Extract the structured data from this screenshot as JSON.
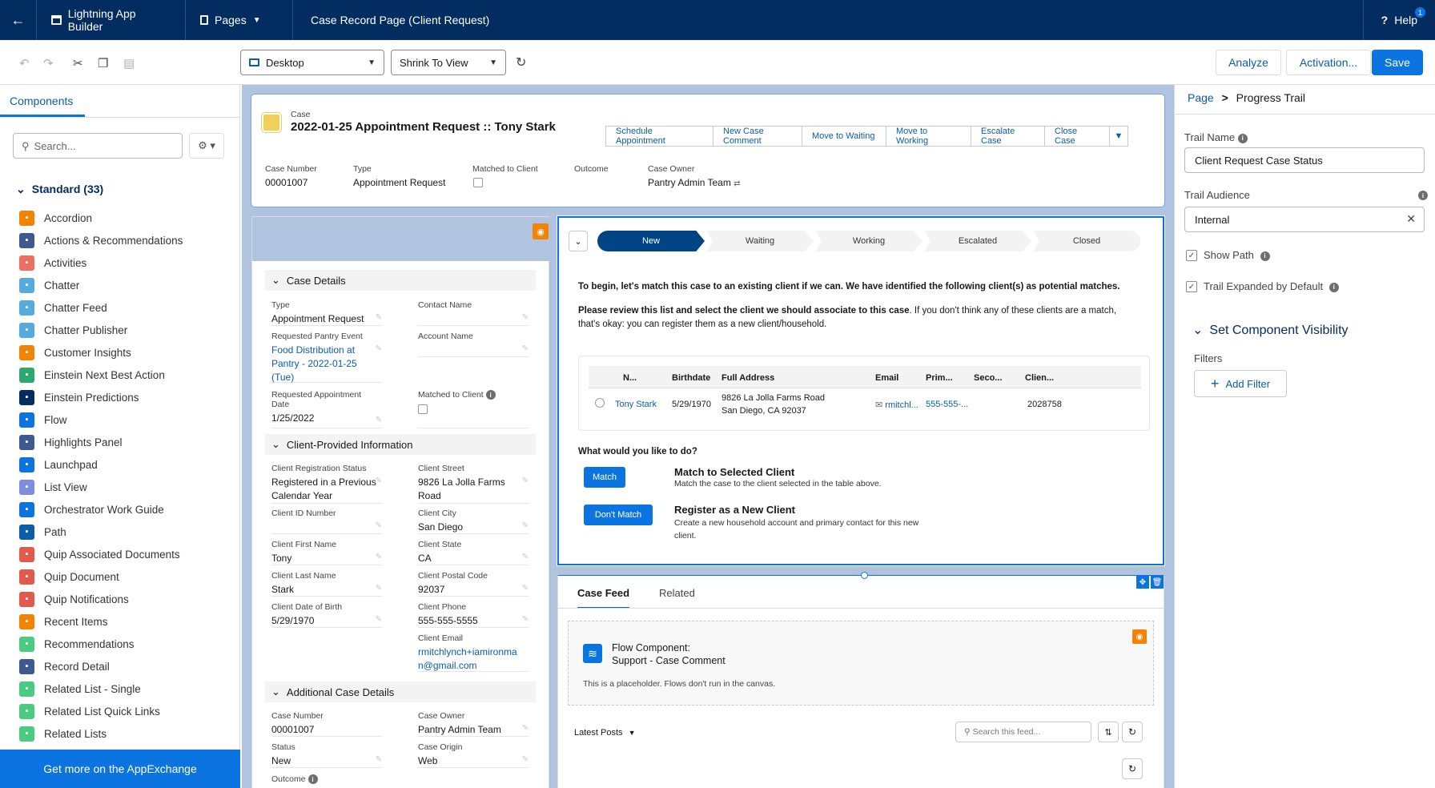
{
  "topbar": {
    "back": "←",
    "app_name": "Lightning App Builder",
    "pages": "Pages",
    "page_title": "Case Record Page (Client Request)",
    "help": "Help",
    "help_badge": "1"
  },
  "toolbar": {
    "device": "Desktop",
    "zoom": "Shrink To View",
    "analyze": "Analyze",
    "activation": "Activation...",
    "save": "Save"
  },
  "left": {
    "tab": "Components",
    "search_placeholder": "Search...",
    "standard_header": "Standard (33)",
    "items": [
      {
        "label": "Accordion",
        "color": "#f38303"
      },
      {
        "label": "Actions & Recommendations",
        "color": "#3c5a8f"
      },
      {
        "label": "Activities",
        "color": "#ef6e64"
      },
      {
        "label": "Chatter",
        "color": "#56aadf"
      },
      {
        "label": "Chatter Feed",
        "color": "#56aadf"
      },
      {
        "label": "Chatter Publisher",
        "color": "#56aadf"
      },
      {
        "label": "Customer Insights",
        "color": "#f38303"
      },
      {
        "label": "Einstein Next Best Action",
        "color": "#2ea86f"
      },
      {
        "label": "Einstein Predictions",
        "color": "#032d60"
      },
      {
        "label": "Flow",
        "color": "#0b74e1"
      },
      {
        "label": "Highlights Panel",
        "color": "#3c5a8f"
      },
      {
        "label": "Launchpad",
        "color": "#0b74e1"
      },
      {
        "label": "List View",
        "color": "#7f8de1"
      },
      {
        "label": "Orchestrator Work Guide",
        "color": "#0b74e1"
      },
      {
        "label": "Path",
        "color": "#0b5cab"
      },
      {
        "label": "Quip Associated Documents",
        "color": "#e15a4b"
      },
      {
        "label": "Quip Document",
        "color": "#e15a4b"
      },
      {
        "label": "Quip Notifications",
        "color": "#e15a4b"
      },
      {
        "label": "Recent Items",
        "color": "#f38303"
      },
      {
        "label": "Recommendations",
        "color": "#4bca81"
      },
      {
        "label": "Record Detail",
        "color": "#3c5a8f"
      },
      {
        "label": "Related List - Single",
        "color": "#4bca81"
      },
      {
        "label": "Related List Quick Links",
        "color": "#4bca81"
      },
      {
        "label": "Related Lists",
        "color": "#4bca81"
      }
    ],
    "appexchange": "Get more on the AppExchange"
  },
  "record": {
    "object": "Case",
    "title": "2022-01-25 Appointment Request :: Tony Stark",
    "actions": [
      "Schedule Appointment",
      "New Case Comment",
      "Move to Waiting",
      "Move to Working",
      "Escalate Case",
      "Close Case"
    ],
    "highlights": [
      {
        "label": "Case Number",
        "value": "00001007"
      },
      {
        "label": "Type",
        "value": "Appointment Request"
      },
      {
        "label": "Matched to Client",
        "value": ""
      },
      {
        "label": "Outcome",
        "value": ""
      },
      {
        "label": "Case Owner",
        "value": "Pantry Admin Team"
      }
    ]
  },
  "details": {
    "sec1": "Case Details",
    "sec2": "Client-Provided Information",
    "sec3": "Additional Case Details",
    "type_l": "Type",
    "type_v": "Appointment Request",
    "contact_l": "Contact Name",
    "event_l": "Requested Pantry Event",
    "event_v": "Food Distribution at Pantry - 2022-01-25 (Tue)",
    "account_l": "Account Name",
    "apptdate_l": "Requested Appointment Date",
    "apptdate_v": "1/25/2022",
    "matched_l": "Matched to Client",
    "regstatus_l": "Client Registration Status",
    "regstatus_v": "Registered in a Previous Calendar Year",
    "street_l": "Client Street",
    "street_v": "9826 La Jolla Farms Road",
    "clientid_l": "Client ID Number",
    "city_l": "Client City",
    "city_v": "San Diego",
    "first_l": "Client First Name",
    "first_v": "Tony",
    "state_l": "Client State",
    "state_v": "CA",
    "last_l": "Client Last Name",
    "last_v": "Stark",
    "postal_l": "Client Postal Code",
    "postal_v": "92037",
    "dob_l": "Client Date of Birth",
    "dob_v": "5/29/1970",
    "phone_l": "Client Phone",
    "phone_v": "555-555-5555",
    "email_l": "Client Email",
    "email_v": "rmitchlynch+iamironman@gmail.com",
    "casenum_l": "Case Number",
    "casenum_v": "00001007",
    "owner_l": "Case Owner",
    "owner_v": "Pantry Admin Team",
    "status_l": "Status",
    "status_v": "New",
    "origin_l": "Case Origin",
    "origin_v": "Web",
    "outcome_l": "Outcome"
  },
  "path": {
    "steps": [
      "New",
      "Waiting",
      "Working",
      "Escalated",
      "Closed"
    ],
    "intro": "To begin, let's match this case to an existing client if we can. We have identified the following client(s) as potential matches.",
    "review_bold": "Please review this list and select the client we should associate to this case",
    "review_rest": ". If you don't think any of these clients are a match, that's okay: you can register them as a new client/household.",
    "columns": [
      "N...",
      "Birthdate",
      "Full Address",
      "Email",
      "Prim...",
      "Seco...",
      "Clien..."
    ],
    "row": {
      "name": "Tony Stark",
      "birthdate": "5/29/1970",
      "addr1": "9826 La Jolla Farms Road",
      "addr2": "San Diego, CA 92037",
      "email": "rmitchl...",
      "phone": "555-555-...",
      "secondary": "",
      "client": "2028758"
    },
    "question": "What would you like to do?",
    "match_btn": "Match",
    "match_title": "Match to Selected Client",
    "match_desc": "Match the case to the client selected in the table above.",
    "nomatch_btn": "Don't Match",
    "register_title": "Register as a New Client",
    "register_desc": "Create a new household account and primary contact for this new client."
  },
  "feed": {
    "tab1": "Case Feed",
    "tab2": "Related",
    "flow_title1": "Flow Component:",
    "flow_title2": "Support - Case Comment",
    "placeholder": "This is a placeholder. Flows don't run in the canvas.",
    "latest": "Latest Posts",
    "search_placeholder": "Search this feed..."
  },
  "right": {
    "breadcrumb_page": "Page",
    "breadcrumb_sep": ">",
    "breadcrumb_current": "Progress Trail",
    "trail_name_label": "Trail Name",
    "trail_name_value": "Client Request Case Status",
    "audience_label": "Trail Audience",
    "audience_value": "Internal",
    "show_path": "Show Path",
    "expanded": "Trail Expanded by Default",
    "visibility": "Set Component Visibility",
    "filters": "Filters",
    "add_filter": "Add Filter"
  }
}
